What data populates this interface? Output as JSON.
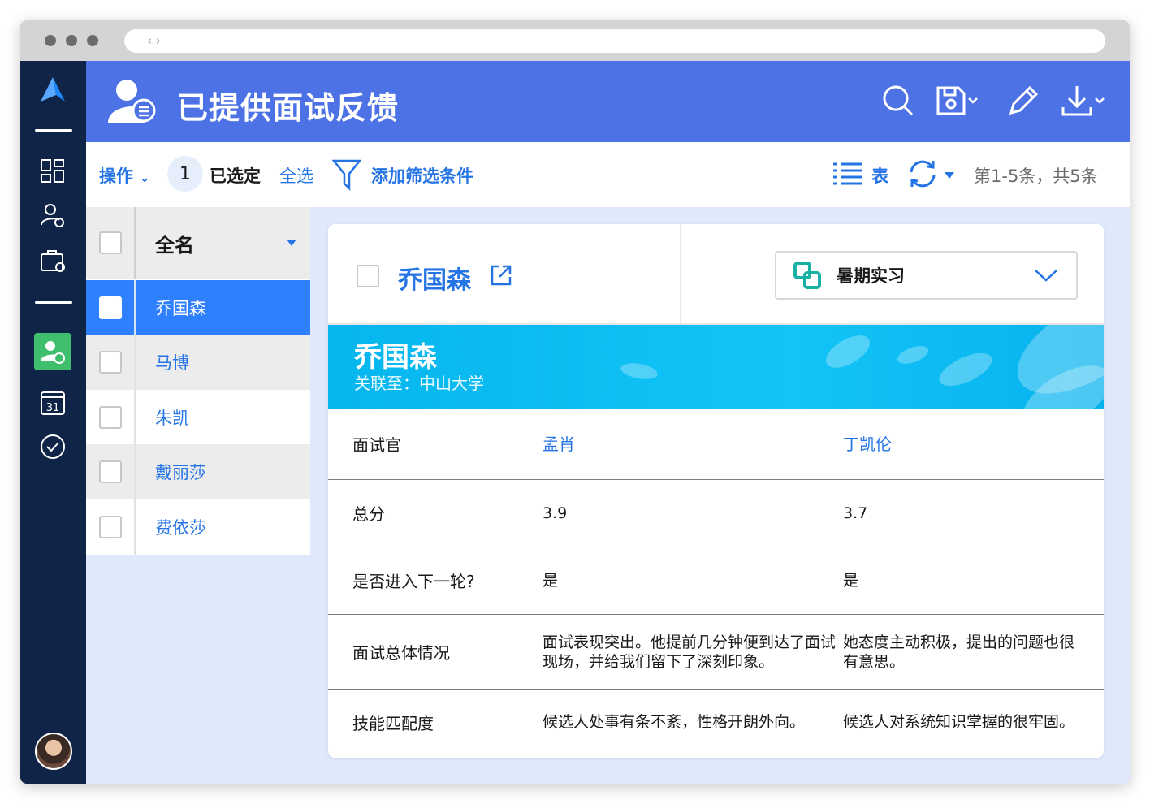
{
  "header": {
    "title": "已提供面试反馈"
  },
  "toolbar": {
    "actions_label": "操作",
    "selected_count": "1",
    "selected_label": "已选定",
    "select_all_label": "全选",
    "add_filter_label": "添加筛选条件",
    "view_label": "表",
    "pagination": "第1-5条，共5条"
  },
  "list": {
    "header": "全名",
    "rows": [
      {
        "name": "乔国森",
        "selected": true
      },
      {
        "name": "马博"
      },
      {
        "name": "朱凯"
      },
      {
        "name": "戴丽莎"
      },
      {
        "name": "费依莎"
      }
    ]
  },
  "detail": {
    "name": "乔国森",
    "position": "暑期实习",
    "banner_name": "乔国森",
    "banner_sub": "关联至：中山大学",
    "rows": [
      {
        "label": "面试官",
        "v1": "孟肖",
        "v2": "丁凯伦"
      },
      {
        "label": "总分",
        "v1": "3.9",
        "v2": "3.7"
      },
      {
        "label": "是否进入下一轮?",
        "v1": "是",
        "v2": "是"
      },
      {
        "label": "面试总体情况",
        "v1": "面试表现突出。他提前几分钟便到达了面试现场，并给我们留下了深刻印象。",
        "v2": "她态度主动积极，提出的问题也很有意思。"
      },
      {
        "label": "技能匹配度",
        "v1": "候选人处事有条不紊，性格开朗外向。",
        "v2": "候选人对系统知识掌握的很牢固。"
      }
    ]
  },
  "colors": {
    "header": "#4d72e6",
    "sidebar": "#0f2446",
    "accent": "#2574e6",
    "active_nav": "#3fbf6e",
    "banner": "#10c0f5"
  }
}
